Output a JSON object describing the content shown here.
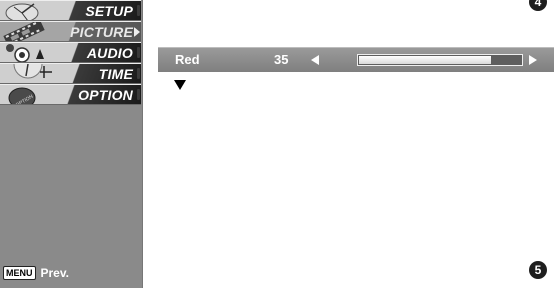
{
  "menu": {
    "items": [
      {
        "label": "SETUP",
        "icon": "satellite-dish-icon"
      },
      {
        "label": "PICTURE",
        "icon": "film-strip-icon"
      },
      {
        "label": "AUDIO",
        "icon": "speaker-icon"
      },
      {
        "label": "TIME",
        "icon": "clock-icon"
      },
      {
        "label": "OPTION",
        "icon": "option-disc-icon"
      }
    ],
    "active_index": 1,
    "menu_key": "MENU",
    "prev_label": "Prev."
  },
  "setting": {
    "label": "Red",
    "value": "35",
    "slider_fraction": 0.82
  },
  "steps": {
    "top": "4",
    "bottom": "5"
  }
}
